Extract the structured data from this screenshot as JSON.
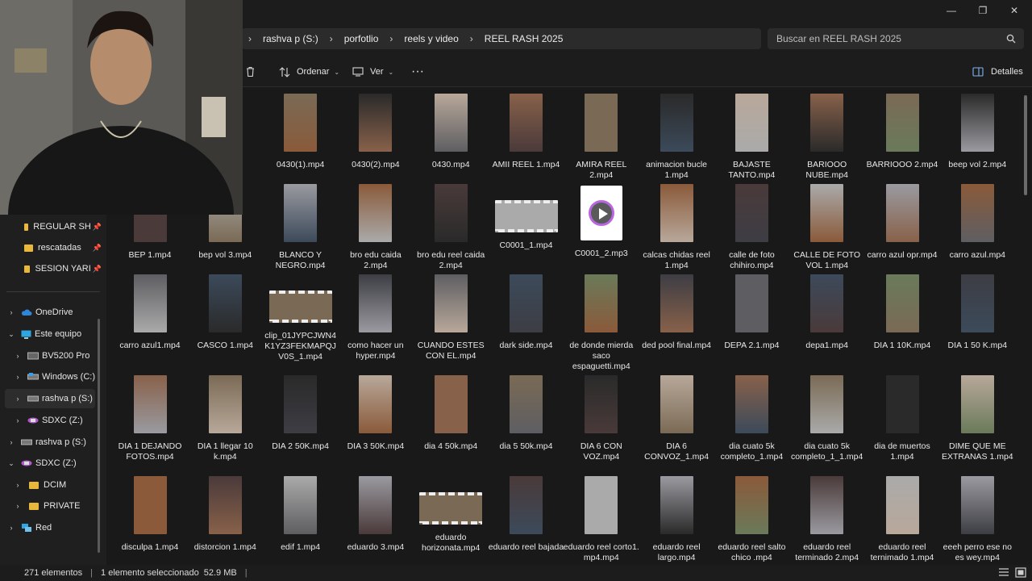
{
  "window": {
    "minimize": "—",
    "maximize": "❐",
    "close": "✕"
  },
  "breadcrumb": [
    "rashva p (S:)",
    "porfotlio",
    "reels y video",
    "REEL RASH 2025"
  ],
  "search": {
    "placeholder": "Buscar en REEL RASH 2025"
  },
  "toolbar": {
    "sort_label": "Ordenar",
    "view_label": "Ver",
    "more_label": "···",
    "details_label": "Detalles"
  },
  "sidebar": {
    "quick": [
      {
        "label": "REGULAR SH",
        "pinned": true
      },
      {
        "label": "rescatadas",
        "pinned": true
      },
      {
        "label": "SESION YARI",
        "pinned": true
      }
    ],
    "tree": [
      {
        "label": "OneDrive",
        "icon": "cloud-icon"
      },
      {
        "label": "Este equipo",
        "icon": "computer-icon"
      },
      {
        "label": "BV5200 Pro",
        "icon": "phone-icon"
      },
      {
        "label": "Windows (C:)",
        "icon": "drive-icon"
      },
      {
        "label": "rashva p (S:)",
        "icon": "drive-icon"
      },
      {
        "label": "SDXC (Z:)",
        "icon": "sd-card-icon"
      },
      {
        "label": "rashva p (S:)",
        "icon": "drive-icon"
      },
      {
        "label": "SDXC (Z:)",
        "icon": "sd-card-icon"
      },
      {
        "label": "DCIM",
        "icon": "folder-icon"
      },
      {
        "label": "PRIVATE",
        "icon": "folder-icon"
      },
      {
        "label": "Red",
        "icon": "network-icon"
      }
    ]
  },
  "files": [
    [
      "0430(1).mp4",
      "0430(2).mp4",
      "0430.mp4",
      "AMII REEL 1.mp4",
      "AMIRA REEL 2.mp4",
      "animacion bucle 1.mp4",
      "BAJASTE TANTO.mp4",
      "BARIOOO NUBE.mp4",
      "BARRIOOO 2.mp4",
      "beep vol 2.mp4"
    ],
    [
      "BEP 1.mp4",
      "bep vol 3.mp4",
      "BLANCO Y NEGRO.mp4",
      "bro edu caida 2.mp4",
      "bro edu reel caida 2.mp4",
      "C0001_1.mp4",
      "C0001_2.mp3",
      "calcas chidas reel 1.mp4",
      "calle de foto chihiro.mp4",
      "CALLE DE FOTO VOL 1.mp4",
      "carro azul opr.mp4",
      "carro azul.mp4"
    ],
    [
      "carro azul1.mp4",
      "CASCO 1.mp4",
      "clip_01JYPCJWN4K1YZ3FEKMAPQJV0S_1.mp4",
      "como hacer un hyper.mp4",
      "CUANDO ESTES CON EL.mp4",
      "dark side.mp4",
      "de donde mierda saco espaguetti.mp4",
      "ded pool final.mp4",
      "DEPA 2.1.mp4",
      "depa1.mp4",
      "DIA 1 10K.mp4",
      "DIA 1 50 K.mp4"
    ],
    [
      "DIA 1 DEJANDO FOTOS.mp4",
      "DIA 1 llegar 10 k.mp4",
      "DIA 2 50K.mp4",
      "DIA 3 50K.mp4",
      "dia 4 50k.mp4",
      "dia 5 50k.mp4",
      "DIA 6 CON VOZ.mp4",
      "DIA 6 CONVOZ_1.mp4",
      "dia cuato 5k completo_1.mp4",
      "dia cuato 5k completo_1_1.mp4",
      "dia de muertos 1.mp4",
      "DIME QUE ME EXTRANAS 1.mp4"
    ],
    [
      "disculpa 1.mp4",
      "distorcion 1.mp4",
      "edif 1.mp4",
      "eduardo 3.mp4",
      "eduardo horizonata.mp4",
      "eduardo reel bajada",
      "eduardo reel corto1. mp4.mp4",
      "eduardo reel largo.mp4",
      "eduardo reel salto chico .mp4",
      "eduardo reel terminado 2.mp4",
      "eduardo reel ternimado 1.mp4",
      "eeeh perro ese no es wey.mp4"
    ]
  ],
  "status": {
    "count": "271 elementos",
    "selection": "1 elemento seleccionado",
    "size": "52.9 MB"
  },
  "colors": {
    "background": "#191919",
    "folder": "#e8b73c",
    "drive_selected": "#2d2d2d"
  }
}
